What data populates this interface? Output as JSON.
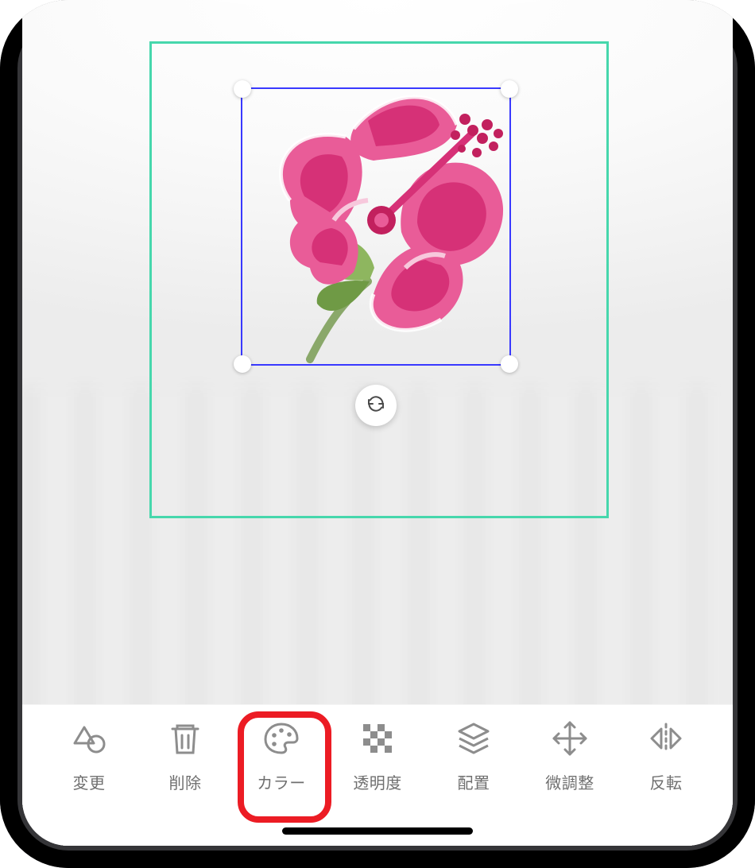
{
  "toolbar": {
    "active_index": 2,
    "items": [
      {
        "id": "change",
        "label": "変更",
        "icon": "shapes-icon"
      },
      {
        "id": "delete",
        "label": "削除",
        "icon": "trash-icon"
      },
      {
        "id": "color",
        "label": "カラー",
        "icon": "palette-icon"
      },
      {
        "id": "opacity",
        "label": "透明度",
        "icon": "transparency-icon"
      },
      {
        "id": "layer",
        "label": "配置",
        "icon": "layers-icon"
      },
      {
        "id": "nudge",
        "label": "微調整",
        "icon": "move-icon"
      },
      {
        "id": "flip",
        "label": "反転",
        "icon": "flip-icon"
      }
    ]
  },
  "canvas": {
    "rotate_button": "rotate",
    "selection_active": true
  },
  "colors": {
    "print_area_border": "#46d7ac",
    "selection_border": "#3939ff",
    "highlight": "#ec1c24",
    "toolbar_text": "#6f6f6f",
    "flower_base": "#e95c98",
    "flower_dark": "#d63177",
    "flower_light": "#f39cc1",
    "flower_leaf": "#7aa84f",
    "flower_stem": "#8aa86a"
  }
}
